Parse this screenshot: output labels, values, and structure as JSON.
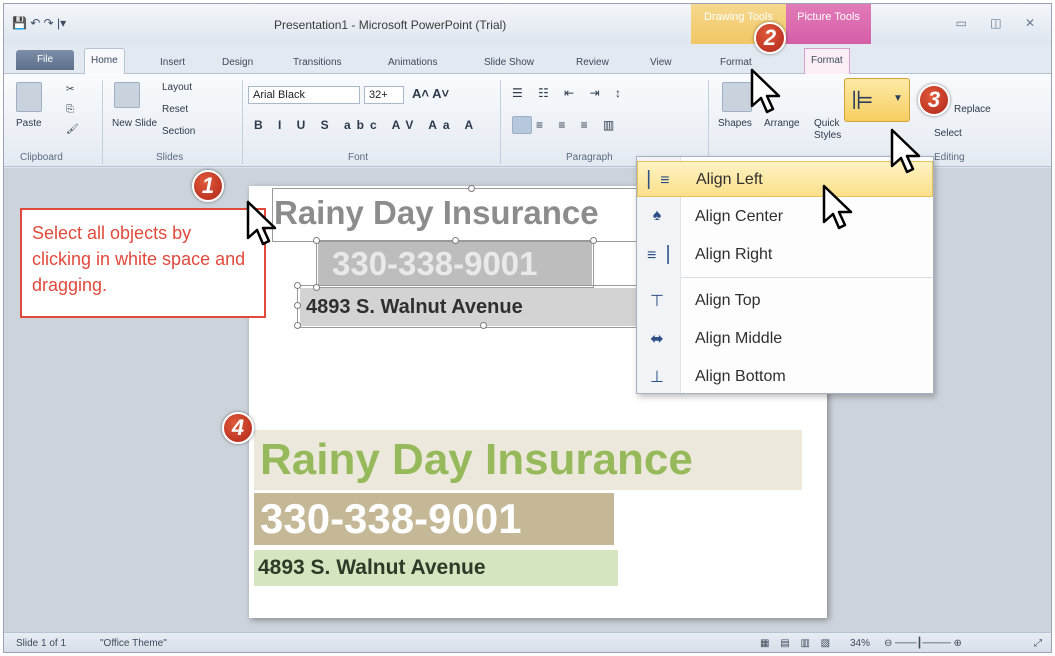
{
  "app": {
    "title": "Presentation1 - Microsoft PowerPoint (Trial)",
    "drawing_tools": "Drawing Tools",
    "picture_tools": "Picture Tools",
    "qat": "💾 ↶ ↷ |▾"
  },
  "tabs": [
    "File",
    "Home",
    "Insert",
    "Design",
    "Transitions",
    "Animations",
    "Slide Show",
    "Review",
    "View",
    "Format",
    "Format"
  ],
  "ribbon": {
    "clipboard": {
      "paste": "Paste",
      "label": "Clipboard"
    },
    "slides": {
      "new_slide": "New Slide",
      "layout": "Layout",
      "reset": "Reset",
      "section": "Section",
      "label": "Slides"
    },
    "font": {
      "name": "Arial Black",
      "size": "32+",
      "label": "Font"
    },
    "paragraph": {
      "label": "Paragraph"
    },
    "drawing": {
      "shapes": "Shapes",
      "arrange": "Arrange",
      "quick_styles": "Quick Styles"
    },
    "editing": {
      "replace": "Replace",
      "select": "Select",
      "label": "Editing"
    }
  },
  "callout": {
    "text": "Select all objects by clicking in white space and dragging."
  },
  "slide_top": {
    "title": "Rainy Day Insurance",
    "phone": "330-338-9001",
    "address": "4893 S. Walnut Avenue"
  },
  "slide_bottom": {
    "title": "Rainy Day Insurance",
    "phone": "330-338-9001",
    "address": "4893 S. Walnut Avenue"
  },
  "align_menu": [
    {
      "label": "Align Left",
      "icon": "align-left-icon",
      "glyph": "▏≡",
      "highlighted": true
    },
    {
      "label": "Align Center",
      "icon": "align-center-icon",
      "glyph": "♠",
      "highlighted": false
    },
    {
      "label": "Align Right",
      "icon": "align-right-icon",
      "glyph": "≡▕",
      "highlighted": false
    },
    {
      "label": "Align Top",
      "icon": "align-top-icon",
      "glyph": "⊤",
      "highlighted": false
    },
    {
      "label": "Align Middle",
      "icon": "align-middle-icon",
      "glyph": "⬌",
      "highlighted": false
    },
    {
      "label": "Align Bottom",
      "icon": "align-bottom-icon",
      "glyph": "⊥",
      "highlighted": false
    }
  ],
  "badges": [
    "1",
    "2",
    "3",
    "4"
  ],
  "status": {
    "slide": "Slide 1 of 1",
    "theme": "\"Office Theme\"",
    "zoom": "34%"
  },
  "colors": {
    "accent_red": "#e04a3c",
    "title_green": "#96ba5b",
    "phone_tan": "#c4b896",
    "addr_green": "#d5e5c0"
  }
}
